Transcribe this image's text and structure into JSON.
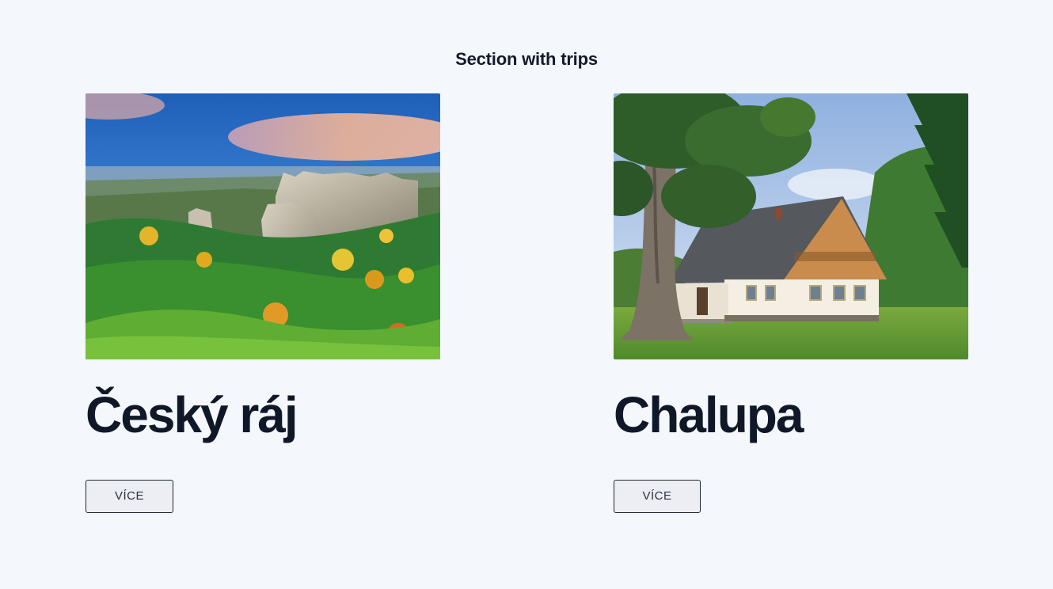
{
  "section": {
    "title": "Section with trips"
  },
  "trips": [
    {
      "title": "Český ráj",
      "image_alt": "rock towers among autumn forest",
      "button_label": "VÍCE"
    },
    {
      "title": "Chalupa",
      "image_alt": "cottage with wooden gable next to a large tree",
      "button_label": "VÍCE"
    }
  ],
  "colors": {
    "background": "#f4f7fb",
    "text": "#101828",
    "button_bg": "#eceef3",
    "button_border": "#1f2937"
  }
}
